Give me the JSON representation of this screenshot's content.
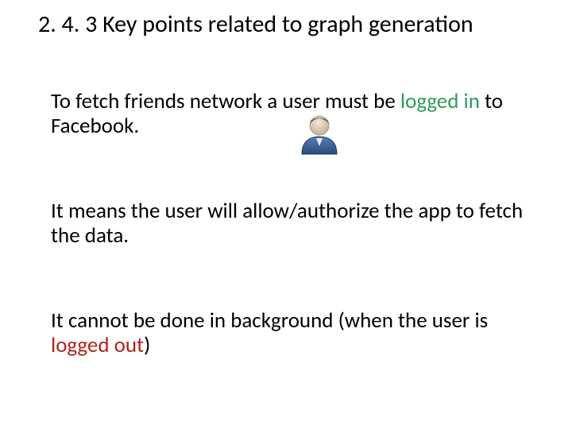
{
  "title": "2. 4. 3 Key points related to graph generation",
  "p1": {
    "lead": "To fetch friends network a user must be ",
    "logged": "logged ",
    "in": "in",
    "tail": " to Facebook."
  },
  "p2": "It means the user will allow/authorize the app to fetch the data.",
  "p3": {
    "lead": "It cannot be done in background (when the user is ",
    "logged_out": "logged out",
    "tail": ")"
  },
  "icon": "user-icon"
}
